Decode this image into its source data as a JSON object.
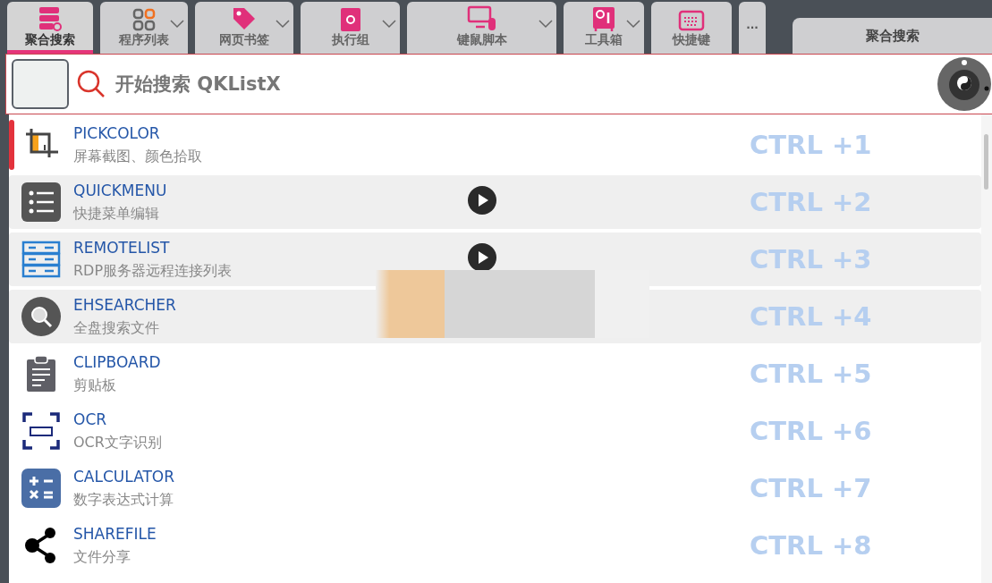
{
  "tabs": [
    {
      "label": "聚合搜索",
      "kind": "server",
      "dropdown": false,
      "selected": true
    },
    {
      "label": "程序列表",
      "kind": "grid",
      "dropdown": true,
      "selected": false
    },
    {
      "label": "网页书签",
      "kind": "tag",
      "dropdown": true,
      "selected": false
    },
    {
      "label": "执行组",
      "kind": "box",
      "dropdown": true,
      "selected": false
    },
    {
      "label": "键鼠脚本",
      "kind": "monitor",
      "dropdown": true,
      "selected": false
    },
    {
      "label": "工具箱",
      "kind": "safe",
      "dropdown": true,
      "selected": false
    },
    {
      "label": "快捷键",
      "kind": "keyboard",
      "dropdown": false,
      "selected": false
    }
  ],
  "more": "···",
  "panel_title": "聚合搜索",
  "search": {
    "placeholder": "开始搜索 QKListX"
  },
  "items": [
    {
      "name": "PICKCOLOR",
      "desc": "屏幕截图、颜色拾取",
      "shortcut": "CTRL +1",
      "kind": "crop",
      "selected": true,
      "shaded": false,
      "play": false
    },
    {
      "name": "QUICKMENU",
      "desc": "快捷菜单编辑",
      "shortcut": "CTRL +2",
      "kind": "list",
      "selected": false,
      "shaded": true,
      "play": true
    },
    {
      "name": "REMOTELIST",
      "desc": "RDP服务器远程连接列表",
      "shortcut": "CTRL +3",
      "kind": "servers",
      "selected": false,
      "shaded": true,
      "play": true
    },
    {
      "name": "EHSEARCHER",
      "desc": "全盘搜索文件",
      "shortcut": "CTRL +4",
      "kind": "search",
      "selected": false,
      "shaded": true,
      "play": false
    },
    {
      "name": "CLIPBOARD",
      "desc": "剪贴板",
      "shortcut": "CTRL +5",
      "kind": "clipboard",
      "selected": false,
      "shaded": false,
      "play": false
    },
    {
      "name": "OCR",
      "desc": "OCR文字识别",
      "shortcut": "CTRL +6",
      "kind": "ocr",
      "selected": false,
      "shaded": false,
      "play": false
    },
    {
      "name": "CALCULATOR",
      "desc": "数字表达式计算",
      "shortcut": "CTRL +7",
      "kind": "calc",
      "selected": false,
      "shaded": false,
      "play": false
    },
    {
      "name": "SHAREFILE",
      "desc": "文件分享",
      "shortcut": "CTRL +8",
      "kind": "share",
      "selected": false,
      "shaded": false,
      "play": false
    }
  ]
}
